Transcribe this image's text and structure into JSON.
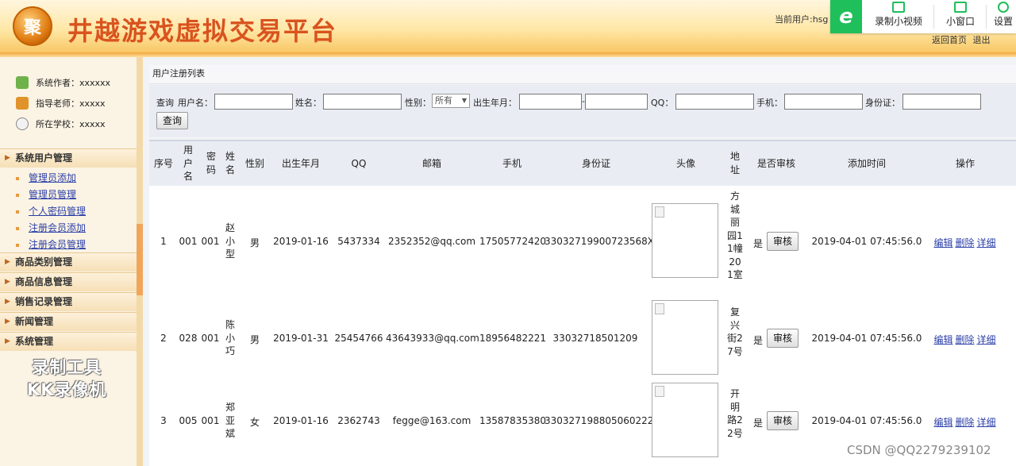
{
  "header": {
    "logo_text": "聚",
    "site_title": "井越游戏虚拟交易平台",
    "current_user": "当前用户:hsg",
    "links": [
      "返回首页",
      "退出"
    ]
  },
  "recorder": {
    "logo": "e",
    "buttons": [
      "录制小视频",
      "小窗口",
      "设置"
    ]
  },
  "sidebar": {
    "info": [
      {
        "label": "系统作者：xxxxxx",
        "icon": "users-icon"
      },
      {
        "label": "指导老师：xxxxx",
        "icon": "teacher-icon"
      },
      {
        "label": "所在学校：xxxxx",
        "icon": "school-icon"
      }
    ],
    "sections": [
      "系统用户管理",
      "商品类别管理",
      "商品信息管理",
      "销售记录管理",
      "新闻管理",
      "系统管理"
    ],
    "sub_items": [
      "管理员添加",
      "管理员管理",
      "个人密码管理",
      "注册会员添加",
      "注册会员管理"
    ],
    "watermark": [
      "录制工具",
      "KK录像机"
    ]
  },
  "panel": {
    "title": "用户注册列表"
  },
  "search": {
    "prefix": "查询",
    "username_label": "用户名：",
    "name_label": "姓名：",
    "gender_label": "性别：",
    "gender_value": "所有",
    "birth_label": "出生年月：",
    "birth_sep": "-",
    "qq_label": "QQ：",
    "phone_label": "手机：",
    "id_label": "身份证：",
    "button": "查询"
  },
  "table": {
    "headers": [
      "序号",
      "用户名",
      "密码",
      "姓名",
      "性别",
      "出生年月",
      "QQ",
      "邮箱",
      "手机",
      "身份证",
      "头像",
      "地址",
      "是否审核",
      "添加时间",
      "操作"
    ],
    "rows": [
      {
        "no": "1",
        "user": "001",
        "pwd": "001",
        "name": "赵小型",
        "gender": "男",
        "birth": "2019-01-16",
        "qq": "5437334",
        "email": "2352352@qq.com",
        "phone": "17505772420",
        "idcard": "33032719900723568X",
        "address": "方城丽园11幢201室",
        "audit": "是",
        "audit_btn": "审核",
        "time": "2019-04-01 07:45:56.0"
      },
      {
        "no": "2",
        "user": "028",
        "pwd": "001",
        "name": "陈小巧",
        "gender": "男",
        "birth": "2019-01-31",
        "qq": "25454766",
        "email": "43643933@qq.com",
        "phone": "18956482221",
        "idcard": "33032718501209",
        "address": "复兴街27号",
        "audit": "是",
        "audit_btn": "审核",
        "time": "2019-04-01 07:45:56.0"
      },
      {
        "no": "3",
        "user": "005",
        "pwd": "001",
        "name": "郑亚斌",
        "gender": "女",
        "birth": "2019-01-16",
        "qq": "2362743",
        "email": "fegge@163.com",
        "phone": "13587835380",
        "idcard": "330327198805060222",
        "address": "开明路22号",
        "audit": "是",
        "audit_btn": "审核",
        "time": "2019-04-01 07:45:56.0"
      }
    ],
    "ops": [
      "编辑",
      "删除",
      "详细"
    ]
  },
  "watermark_csdn": "CSDN @QQ2279239102"
}
